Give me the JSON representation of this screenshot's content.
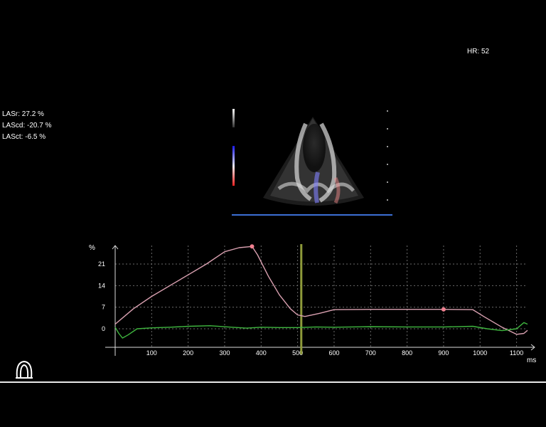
{
  "header": {
    "hr": "HR: 52"
  },
  "metrics": [
    {
      "label": "LASr: 27.2 %"
    },
    {
      "label": "LAScd: -20.7 %"
    },
    {
      "label": "LASct: -6.5 %"
    }
  ],
  "colors": {
    "strain": "#d9a0b0",
    "reference": "#3fb63f",
    "marker": "#8e9a3a",
    "dot": "#f08090",
    "grid": "#6a6a6a"
  },
  "chart_data": {
    "type": "line",
    "ylabel": "%",
    "xlabel": "ms",
    "xlim": [
      0,
      1130
    ],
    "ylim": [
      -6,
      27
    ],
    "xticks": [
      100,
      200,
      300,
      400,
      500,
      600,
      700,
      800,
      900,
      1000,
      1100
    ],
    "yticks": [
      0,
      7,
      14,
      21
    ],
    "grid": true,
    "vertical_marker_x": 510,
    "series": [
      {
        "values": [
          [
            0,
            1.5
          ],
          [
            20,
            3.5
          ],
          [
            50,
            6.5
          ],
          [
            100,
            10.5
          ],
          [
            150,
            14
          ],
          [
            200,
            17.5
          ],
          [
            250,
            21
          ],
          [
            300,
            25
          ],
          [
            340,
            26.3
          ],
          [
            375,
            26.7
          ],
          [
            390,
            24
          ],
          [
            420,
            17
          ],
          [
            450,
            11
          ],
          [
            480,
            6.5
          ],
          [
            500,
            4.5
          ],
          [
            520,
            4
          ],
          [
            560,
            5
          ],
          [
            600,
            6.2
          ],
          [
            700,
            6.3
          ],
          [
            800,
            6.3
          ],
          [
            900,
            6.3
          ],
          [
            980,
            6.2
          ],
          [
            1010,
            4
          ],
          [
            1060,
            0.5
          ],
          [
            1100,
            -1.8
          ],
          [
            1120,
            -1.5
          ],
          [
            1130,
            -0.5
          ]
        ],
        "markers": [
          [
            375,
            26.7
          ],
          [
            900,
            6.3
          ]
        ]
      },
      {
        "values": [
          [
            0,
            0.5
          ],
          [
            10,
            -1.5
          ],
          [
            20,
            -3
          ],
          [
            35,
            -2
          ],
          [
            60,
            0
          ],
          [
            100,
            0.3
          ],
          [
            150,
            0.5
          ],
          [
            200,
            0.8
          ],
          [
            260,
            1
          ],
          [
            320,
            0.5
          ],
          [
            360,
            0.2
          ],
          [
            400,
            0.5
          ],
          [
            450,
            0.4
          ],
          [
            500,
            0.4
          ],
          [
            550,
            0.6
          ],
          [
            600,
            0.5
          ],
          [
            700,
            0.7
          ],
          [
            800,
            0.6
          ],
          [
            900,
            0.6
          ],
          [
            980,
            0.8
          ],
          [
            1020,
            0
          ],
          [
            1060,
            -0.6
          ],
          [
            1100,
            0
          ],
          [
            1120,
            2
          ],
          [
            1130,
            1.5
          ]
        ]
      }
    ]
  }
}
